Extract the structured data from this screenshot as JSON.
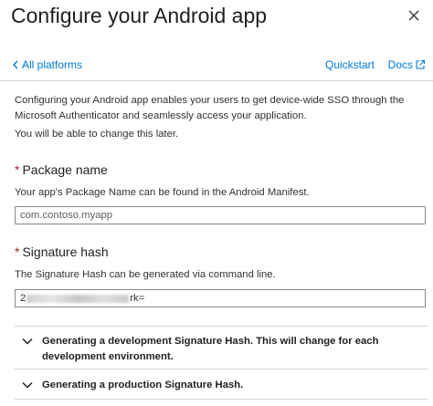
{
  "header": {
    "title": "Configure your Android app"
  },
  "nav": {
    "back_label": "All platforms",
    "quickstart_label": "Quickstart",
    "docs_label": "Docs"
  },
  "description": {
    "line1": "Configuring your Android app enables your users to get device-wide SSO through the Microsoft Authenticator and seamlessly access your application.",
    "line2": "You will be able to change this later."
  },
  "package": {
    "label": "Package name",
    "required_marker": "*",
    "hint": "Your app's Package Name can be found in the Android Manifest.",
    "value": "com.contoso.myapp"
  },
  "signature": {
    "label": "Signature hash",
    "required_marker": "*",
    "hint": "The Signature Hash can be generated via command line.",
    "value_prefix": "2",
    "value_suffix": "rk="
  },
  "accordion": [
    {
      "label": "Generating a development Signature Hash. This will change for each development environment."
    },
    {
      "label": "Generating a production Signature Hash."
    }
  ],
  "icons": {
    "close": "close-icon",
    "back": "chevron-left-icon",
    "external": "external-link-icon",
    "expand": "chevron-down-icon"
  },
  "colors": {
    "accent": "#0078d4",
    "required": "#a4262c"
  }
}
